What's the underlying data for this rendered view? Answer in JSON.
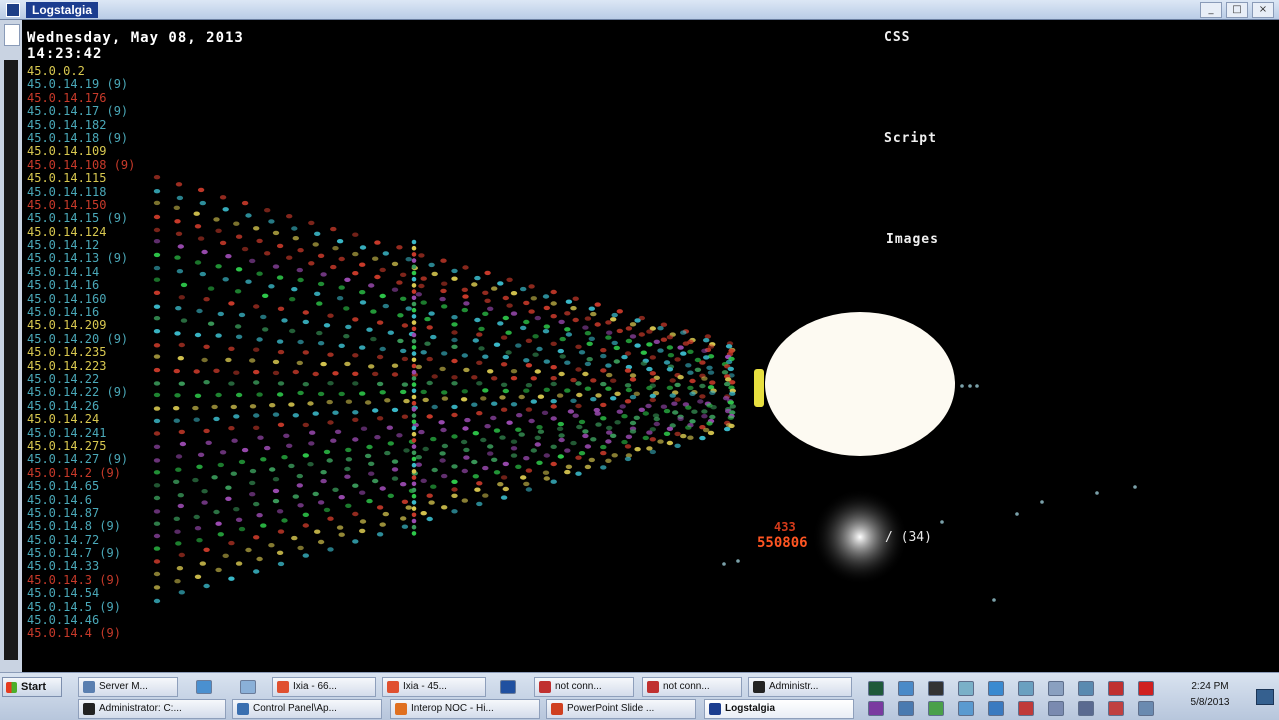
{
  "window": {
    "title": "Logstalgia"
  },
  "hud": {
    "date": "Wednesday, May 08, 2013",
    "time": "14:23:42",
    "ips": [
      {
        "text": "45.0.0.2",
        "color": "#d8c850"
      },
      {
        "text": "45.0.14.19 (9)",
        "color": "#4aa8b8"
      },
      {
        "text": "45.0.14.176",
        "color": "#c83a2a"
      },
      {
        "text": "45.0.14.17 (9)",
        "color": "#4aa8b8"
      },
      {
        "text": "45.0.14.182",
        "color": "#4aa8b8"
      },
      {
        "text": "45.0.14.18 (9)",
        "color": "#4aa8b8"
      },
      {
        "text": "45.0.14.109",
        "color": "#d8c850"
      },
      {
        "text": "45.0.14.108 (9)",
        "color": "#c83a2a"
      },
      {
        "text": "45.0.14.115",
        "color": "#d8c850"
      },
      {
        "text": "45.0.14.118",
        "color": "#4aa8b8"
      },
      {
        "text": "45.0.14.150",
        "color": "#c83a2a"
      },
      {
        "text": "45.0.14.15 (9)",
        "color": "#4aa8b8"
      },
      {
        "text": "45.0.14.124",
        "color": "#d8c850"
      },
      {
        "text": "45.0.14.12",
        "color": "#4aa8b8"
      },
      {
        "text": "45.0.14.13 (9)",
        "color": "#4aa8b8"
      },
      {
        "text": "45.0.14.14",
        "color": "#4aa8b8"
      },
      {
        "text": "45.0.14.16",
        "color": "#4aa8b8"
      },
      {
        "text": "45.0.14.160",
        "color": "#4aa8b8"
      },
      {
        "text": "45.0.14.16",
        "color": "#4aa8b8"
      },
      {
        "text": "45.0.14.209",
        "color": "#d8c850"
      },
      {
        "text": "45.0.14.20 (9)",
        "color": "#4aa8b8"
      },
      {
        "text": "45.0.14.235",
        "color": "#d8c850"
      },
      {
        "text": "45.0.14.223",
        "color": "#d8c850"
      },
      {
        "text": "45.0.14.22",
        "color": "#4aa8b8"
      },
      {
        "text": "45.0.14.22 (9)",
        "color": "#4aa8b8"
      },
      {
        "text": "45.0.14.26",
        "color": "#4aa8b8"
      },
      {
        "text": "45.0.14.24",
        "color": "#d8c850"
      },
      {
        "text": "45.0.14.241",
        "color": "#4aa8b8"
      },
      {
        "text": "45.0.14.275",
        "color": "#d8c850"
      },
      {
        "text": "45.0.14.27 (9)",
        "color": "#4aa8b8"
      },
      {
        "text": "45.0.14.2 (9)",
        "color": "#c83a2a"
      },
      {
        "text": "45.0.14.65",
        "color": "#4aa8b8"
      },
      {
        "text": "45.0.14.6",
        "color": "#4aa8b8"
      },
      {
        "text": "45.0.14.87",
        "color": "#4aa8b8"
      },
      {
        "text": "45.0.14.8 (9)",
        "color": "#4aa8b8"
      },
      {
        "text": "45.0.14.72",
        "color": "#4aa8b8"
      },
      {
        "text": "45.0.14.7 (9)",
        "color": "#4aa8b8"
      },
      {
        "text": "45.0.14.33",
        "color": "#4aa8b8"
      },
      {
        "text": "45.0.14.3 (9)",
        "color": "#c83a2a"
      },
      {
        "text": "45.0.14.54",
        "color": "#4aa8b8"
      },
      {
        "text": "45.0.14.5 (9)",
        "color": "#4aa8b8"
      },
      {
        "text": "45.0.14.46",
        "color": "#4aa8b8"
      },
      {
        "text": "45.0.14.4 (9)",
        "color": "#c83a2a"
      }
    ]
  },
  "categories": {
    "css": "CSS",
    "script": "Script",
    "images": "Images"
  },
  "events": {
    "code_a": "433",
    "code_b": "550806",
    "request_count": "/ (34)"
  },
  "colors": {
    "streams": [
      "#3ab8c8",
      "#d8c850",
      "#c83a2a",
      "#9a4ab0",
      "#3a9a5a",
      "#2ec84a"
    ],
    "paddle": "#e8e040"
  },
  "taskbar": {
    "start": "Start",
    "buttons": [
      {
        "label": "Server M...",
        "icon_color": "#5a7fb0"
      },
      {
        "label": "Ixia - 66...",
        "icon_color": "#e05030"
      },
      {
        "label": "Ixia - 45...",
        "icon_color": "#e05030"
      },
      {
        "label": "not conn...",
        "icon_color": "#c03030"
      },
      {
        "label": "not conn...",
        "icon_color": "#c03030"
      },
      {
        "label": "Administr...",
        "icon_color": "#222222"
      },
      {
        "label": "Administrator: C:...",
        "icon_color": "#222222"
      },
      {
        "label": "Control Panel\\Ap...",
        "icon_color": "#3a6fb0"
      },
      {
        "label": "Interop NOC - Hi...",
        "icon_color": "#e07020"
      },
      {
        "label": "PowerPoint Slide ...",
        "icon_color": "#d04020"
      },
      {
        "label": "Logstalgia",
        "icon_color": "#1b3d8f"
      }
    ],
    "clock_time": "2:24 PM",
    "clock_date": "5/8/2013"
  }
}
